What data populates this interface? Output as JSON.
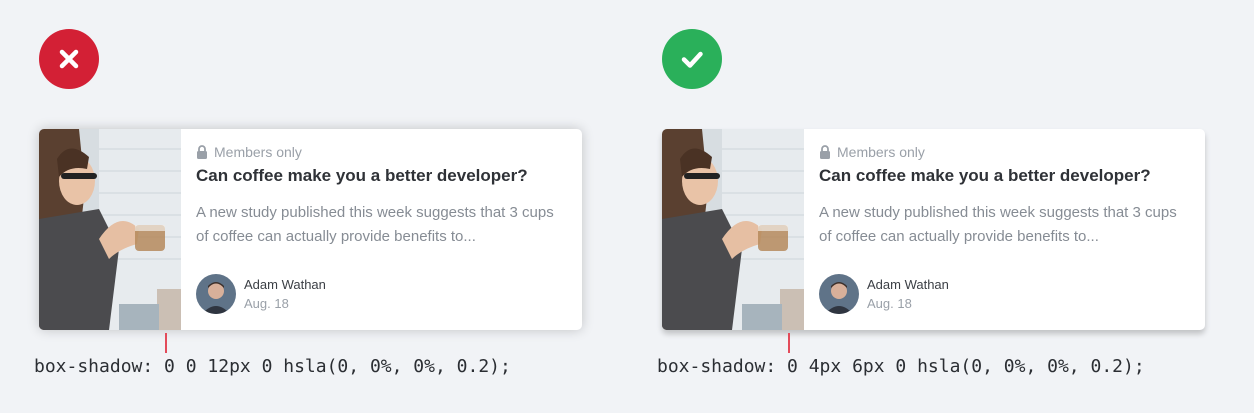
{
  "colors": {
    "bad": "#d32035",
    "good": "#2ab05a",
    "marker": "#e34b5a"
  },
  "examples": [
    {
      "status": "incorrect",
      "status_icon": "x-icon",
      "card": {
        "members_label": "Members only",
        "title": "Can coffee make you a better developer?",
        "excerpt": "A new study published this week suggests that 3 cups of coffee can actually provide benefits to...",
        "author_name": "Adam Wathan",
        "author_date": "Aug. 18"
      },
      "code": "box-shadow: 0 0 12px 0 hsla(0, 0%, 0%, 0.2);"
    },
    {
      "status": "correct",
      "status_icon": "check-icon",
      "card": {
        "members_label": "Members only",
        "title": "Can coffee make you a better developer?",
        "excerpt": "A new study published this week suggests that 3 cups of coffee can actually provide benefits to...",
        "author_name": "Adam Wathan",
        "author_date": "Aug. 18"
      },
      "code": "box-shadow: 0 4px 6px 0 hsla(0, 0%, 0%, 0.2);"
    }
  ]
}
